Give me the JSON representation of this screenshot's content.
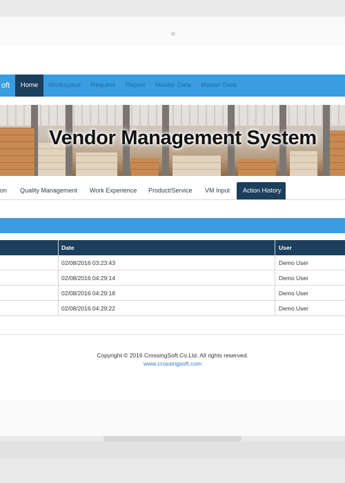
{
  "app": {
    "brand": "oft",
    "title": "Vendor Management System"
  },
  "topnav": {
    "items": [
      {
        "label": "Home",
        "active": true
      },
      {
        "label": "Workspace"
      },
      {
        "label": "Request"
      },
      {
        "label": "Report"
      },
      {
        "label": "Master Data"
      },
      {
        "label": "Master Data"
      }
    ]
  },
  "tabs": {
    "items": [
      {
        "label": "on"
      },
      {
        "label": "Quality Management"
      },
      {
        "label": "Work Experience"
      },
      {
        "label": "Product/Service"
      },
      {
        "label": "VM Input"
      },
      {
        "label": "Action History",
        "active": true
      }
    ]
  },
  "table": {
    "headers": {
      "date": "Date",
      "user": "User"
    },
    "rows": [
      {
        "date": "02/08/2016 03:23:43",
        "user": "Demo User"
      },
      {
        "date": "02/08/2016 04:29:14",
        "user": "Demo User"
      },
      {
        "date": "02/08/2016 04:29:18",
        "user": "Demo User"
      },
      {
        "date": "02/08/2016 04:29:22",
        "user": "Demo User"
      }
    ]
  },
  "footer": {
    "copyright": "Copyright © 2016 CrossingSoft.Co.Ltd. All rights reserved.",
    "website": "www.crossingsoft.com"
  },
  "colors": {
    "primary_blue": "#3a9ddf",
    "dark_navy": "#1b3f5c",
    "link": "#3a78c2"
  }
}
